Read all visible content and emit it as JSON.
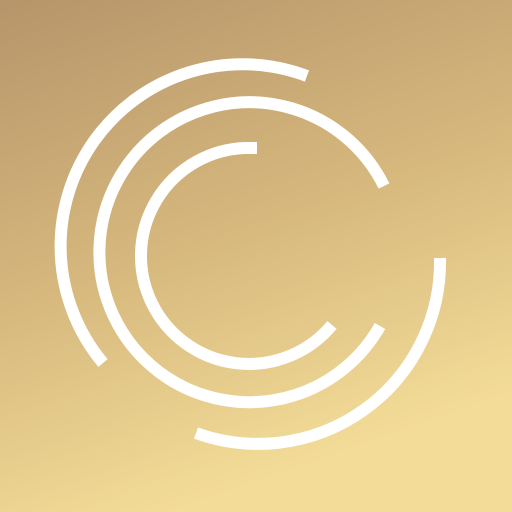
{
  "background": {
    "gradient_start": "#B6956A",
    "gradient_mid": "#D7B97E",
    "gradient_end": "#F3DC98"
  },
  "logo": {
    "icon": "concentric-arcs-logo-icon",
    "stroke_color": "#FFFFFF"
  }
}
